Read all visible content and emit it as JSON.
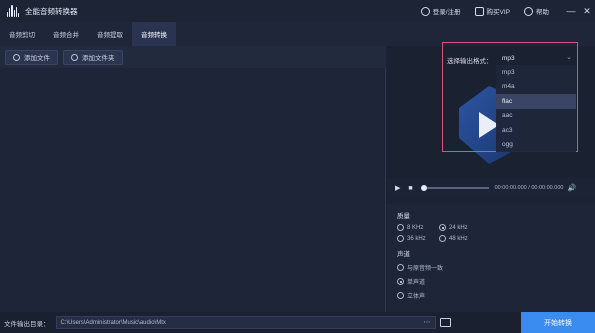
{
  "app": {
    "title": "全能音频转换器",
    "login_label": "登录/注册",
    "vip_label": "购买VIP",
    "help_label": "帮助"
  },
  "tabs": [
    {
      "label": "音频剪切",
      "active": false
    },
    {
      "label": "音频合并",
      "active": false
    },
    {
      "label": "音频提取",
      "active": false
    },
    {
      "label": "音频转换",
      "active": true
    }
  ],
  "toolbar": {
    "add_file_label": "添加文件",
    "add_folder_label": "添加文件夹"
  },
  "format": {
    "label": "选择输出格式：",
    "selected": "mp3",
    "options": [
      "mp3",
      "m4a",
      "flac",
      "aac",
      "ac3",
      "ogg"
    ],
    "highlighted": "flac"
  },
  "player": {
    "time": "00:00:00.000  /  00:00:00.000",
    "progress": 0
  },
  "settings": {
    "quality_label": "质量",
    "quality_options": [
      {
        "label": "8 KHz",
        "checked": false
      },
      {
        "label": "24 kHz",
        "checked": true
      },
      {
        "label": "36 kHz",
        "checked": false
      },
      {
        "label": "48 kHz",
        "checked": false
      }
    ],
    "channel_label": "声道",
    "channel_options": [
      {
        "label": "与原音频一致",
        "checked": false
      },
      {
        "label": "单声道",
        "checked": true
      },
      {
        "label": "立体声",
        "checked": false
      }
    ]
  },
  "output": {
    "label": "文件输出目录：",
    "path": "C:\\Users\\Administrator\\Music\\audio\\Mtx",
    "start_label": "开始转换"
  },
  "colors": {
    "accent": "#3b8cf0",
    "highlight_border": "#d9547f",
    "background": "#1b2233"
  }
}
